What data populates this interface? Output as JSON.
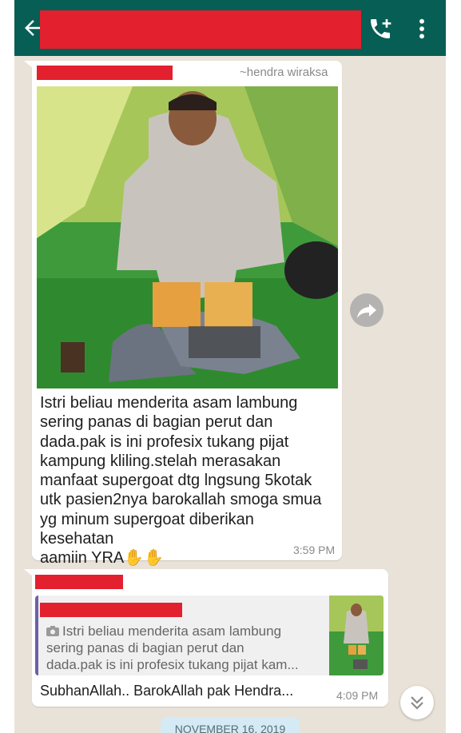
{
  "colors": {
    "header": "#075e54",
    "wallpaper": "#e9e2d8",
    "redaction": "#e2202e",
    "date_chip": "#d4eaf4",
    "quote_bar": "#6e5fa8"
  },
  "header": {
    "back_icon": "arrow-left-icon",
    "add_call_icon": "add-call-icon",
    "menu_icon": "more-vert-icon"
  },
  "messages": [
    {
      "author": "~hendra wiraksa",
      "caption": "Istri beliau  menderita asam lambung\nsering panas di bagian perut dan\ndada.pak is ini profesix tukang pijat\nkampung kliling.stelah merasakan\nmanfaat supergoat dtg lngsung 5kotak\nutk pasien2nya barokallah smoga smua\nyg minum supergoat diberikan kesehatan\naamiin YRA",
      "emoji": "✋✋",
      "time": "3:59 PM"
    },
    {
      "quoted_text": "Istri beliau  menderita asam lambung\nsering panas di bagian perut dan\ndada.pak is ini profesix tukang pijat kam...",
      "text": "SubhanAllah.. BarokAllah pak Hendra...",
      "time": "4:09 PM"
    }
  ],
  "date_chip": "NOVEMBER 16, 2019"
}
